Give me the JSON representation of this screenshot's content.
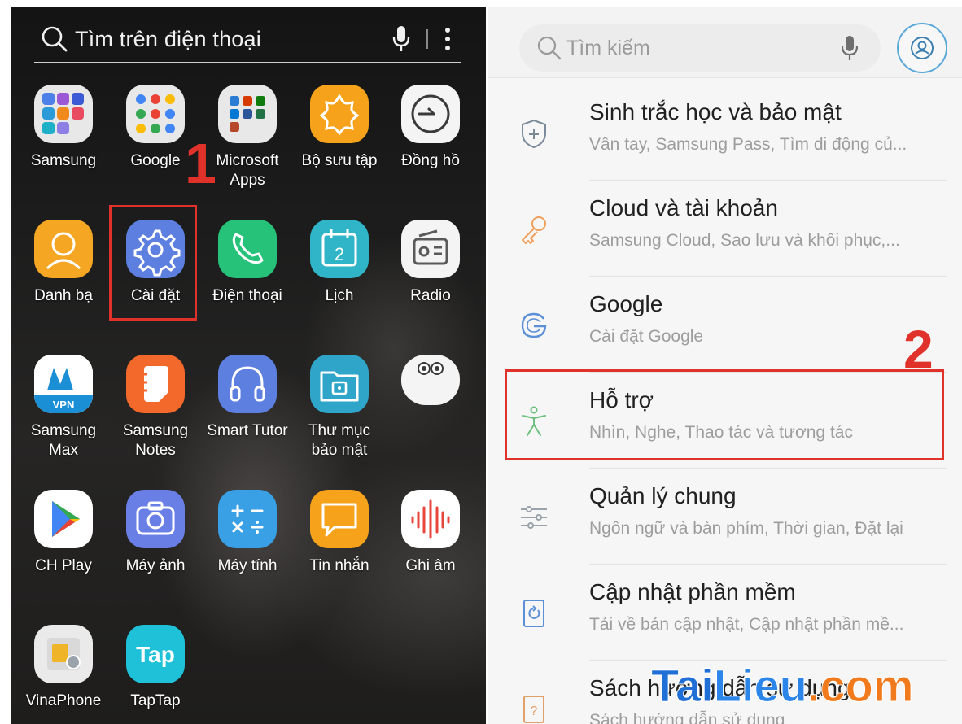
{
  "left": {
    "search_placeholder": "Tìm trên điện thoại",
    "apps": [
      {
        "label": [
          "Samsung"
        ],
        "icon": "samsung-folder-icon",
        "color": "#e8e8e8"
      },
      {
        "label": [
          "Google"
        ],
        "icon": "google-folder-icon",
        "color": "#e8e8e8"
      },
      {
        "label": [
          "Microsoft",
          "Apps"
        ],
        "icon": "microsoft-folder-icon",
        "color": "#e8e8e8"
      },
      {
        "label": [
          "Bộ sưu tập"
        ],
        "icon": "gallery-icon",
        "color": "#f7a21b"
      },
      {
        "label": [
          "Đồng hồ"
        ],
        "icon": "clock-icon",
        "color": "#f4f4f4"
      },
      {
        "label": [
          "Danh bạ"
        ],
        "icon": "contacts-icon",
        "color": "#f5a623"
      },
      {
        "label": [
          "Cài đặt"
        ],
        "icon": "settings-gear-icon",
        "color": "#5d7fe0"
      },
      {
        "label": [
          "Điện thoại"
        ],
        "icon": "phone-icon",
        "color": "#27c27a"
      },
      {
        "label": [
          "Lịch"
        ],
        "icon": "calendar-icon",
        "color": "#2fb5c7"
      },
      {
        "label": [
          "Radio"
        ],
        "icon": "radio-icon",
        "color": "#f4f4f4"
      },
      {
        "label": [
          "Samsung",
          "Max"
        ],
        "icon": "samsung-max-vpn-icon",
        "color": "#ffffff"
      },
      {
        "label": [
          "Samsung",
          "Notes"
        ],
        "icon": "notes-icon",
        "color": "#f2692b"
      },
      {
        "label": [
          "Smart Tutor"
        ],
        "icon": "headset-icon",
        "color": "#5d7fe0"
      },
      {
        "label": [
          "Thư mục",
          "bảo mật"
        ],
        "icon": "secure-folder-icon",
        "color": "#2fa6c9"
      },
      {
        "label": [
          ""
        ],
        "icon": "bixby-eyes-icon",
        "color": "#f4f4f4"
      },
      {
        "label": [
          "CH Play"
        ],
        "icon": "play-store-icon",
        "color": "#ffffff"
      },
      {
        "label": [
          "Máy ảnh"
        ],
        "icon": "camera-icon",
        "color": "#6a7fe6"
      },
      {
        "label": [
          "Máy tính"
        ],
        "icon": "calculator-icon",
        "color": "#3aa0e6"
      },
      {
        "label": [
          "Tin nhắn"
        ],
        "icon": "messages-icon",
        "color": "#f7a21b"
      },
      {
        "label": [
          "Ghi âm"
        ],
        "icon": "voice-recorder-icon",
        "color": "#ffffff"
      },
      {
        "label": [
          "VinaPhone"
        ],
        "icon": "sim-card-icon",
        "color": "#eaeaea"
      },
      {
        "label": [
          "TapTap"
        ],
        "icon": "taptap-icon",
        "color": "#1fc1d8"
      }
    ],
    "step_label": "1"
  },
  "right": {
    "search_placeholder": "Tìm kiếm",
    "settings": [
      {
        "title": "Sinh trắc học và bảo mật",
        "subtitle": "Vân tay, Samsung Pass, Tìm di động củ...",
        "icon": "shield-icon"
      },
      {
        "title": "Cloud và tài khoản",
        "subtitle": "Samsung Cloud, Sao lưu và khôi phục,...",
        "icon": "key-icon"
      },
      {
        "title": "Google",
        "subtitle": "Cài đặt Google",
        "icon": "google-g-icon"
      },
      {
        "title": "Hỗ trợ",
        "subtitle": "Nhìn, Nghe, Thao tác và tương tác",
        "icon": "accessibility-icon"
      },
      {
        "title": "Quản lý chung",
        "subtitle": "Ngôn ngữ và bàn phím, Thời gian, Đặt lại",
        "icon": "sliders-icon"
      },
      {
        "title": "Cập nhật phần mềm",
        "subtitle": "Tải về bản cập nhật, Cập nhật phần mề...",
        "icon": "software-update-icon"
      },
      {
        "title": "Sách hướng dẫn sử dụng",
        "subtitle": "Sách hướng dẫn sử dụng",
        "icon": "manual-icon"
      }
    ],
    "step_label": "2"
  },
  "watermark": {
    "part1": "Tai",
    "part2": "Lieu",
    "part3": ".com"
  },
  "colors": {
    "highlight": "#e0322b",
    "profile_ring": "#5aa8d8"
  }
}
